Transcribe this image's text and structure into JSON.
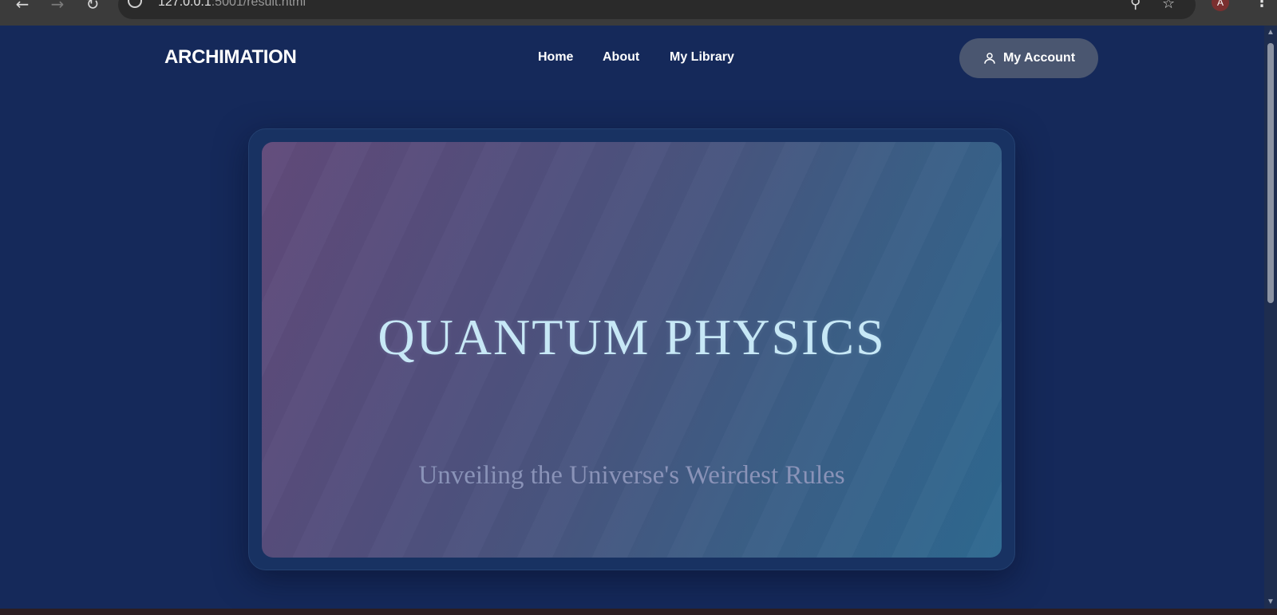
{
  "browser": {
    "url_host": "127.0.0.1",
    "url_rest": ":5001/result.html",
    "profile_initial": "A"
  },
  "header": {
    "logo": "ARCHIMATION",
    "nav": [
      {
        "label": "Home"
      },
      {
        "label": "About"
      },
      {
        "label": "My Library"
      }
    ],
    "account_label": "My Account"
  },
  "hero": {
    "title": "QUANTUM PHYSICS",
    "subtitle": "Unveiling the Universe's Weirdest Rules"
  },
  "colors": {
    "page_background": "#15295a",
    "title_text": "#c7e8f6",
    "subtitle_text": "#8a93b8",
    "account_button": "#4a5670"
  }
}
